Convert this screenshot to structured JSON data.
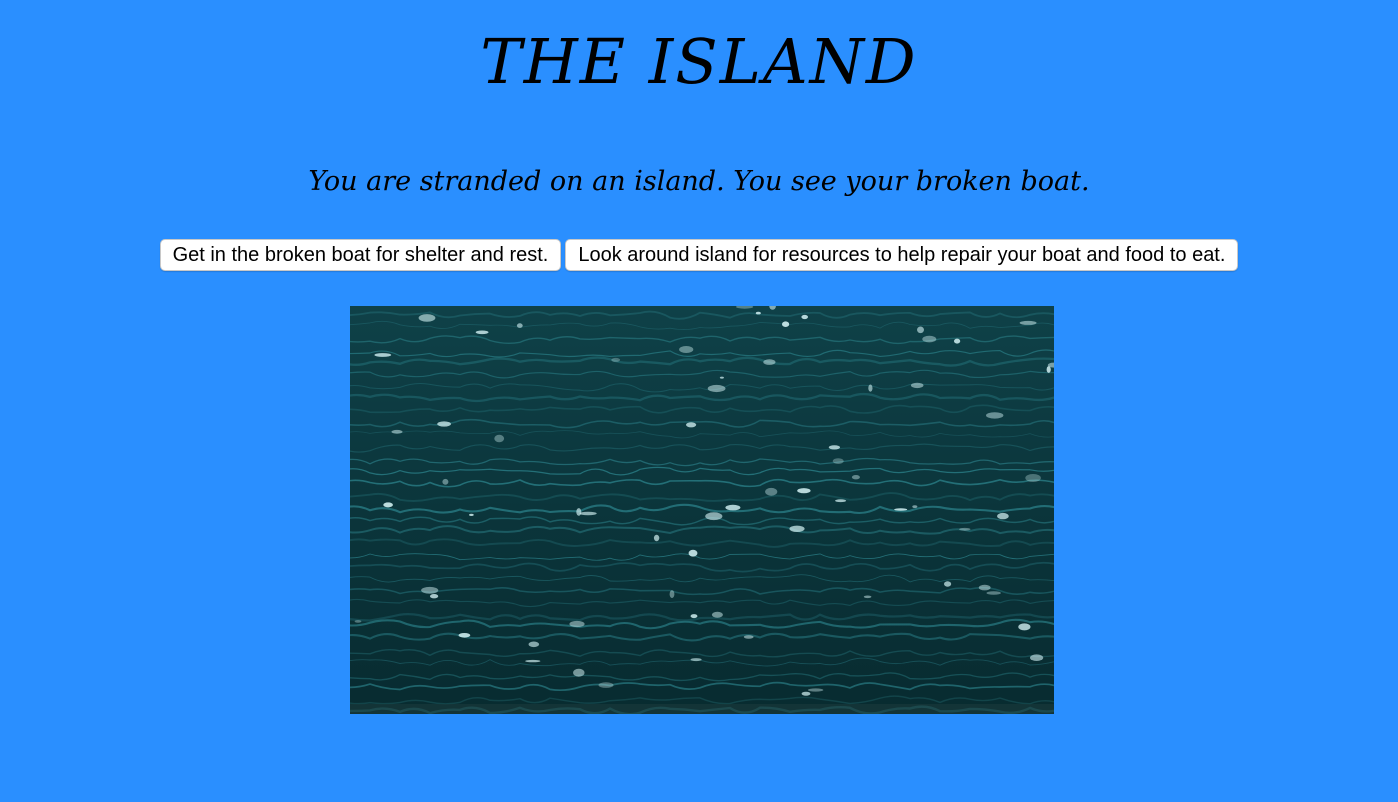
{
  "game": {
    "title": "THE ISLAND",
    "story_text": "You are stranded on an island. You see your broken boat.",
    "choices": [
      {
        "label": "Get in the broken boat for shelter and rest."
      },
      {
        "label": "Look around island for resources to help repair your boat and food to eat."
      }
    ],
    "scene_image": "ocean-waves"
  },
  "colors": {
    "background": "#2a8fff",
    "water_dark": "#0a2f36",
    "water_light": "#2f8a93",
    "foam": "#cfeef0"
  }
}
